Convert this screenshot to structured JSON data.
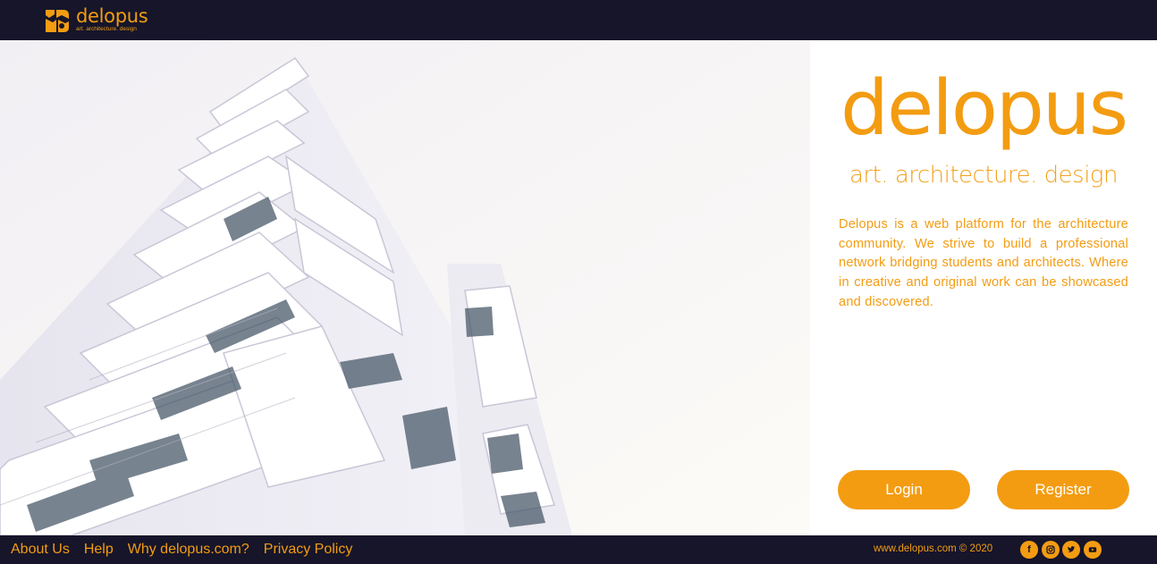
{
  "header": {
    "logo_name": "delopus",
    "logo_tagline": "art. architecture. design"
  },
  "hero": {
    "image": "white-high-rise-building-photo"
  },
  "panel": {
    "brand_name": "delopus",
    "brand_tagline": "art. architecture. design",
    "description": "Delopus is a web platform for the architecture community. We strive to build a professional network bridging students and architects. Where in creative and original work can be showcased and discovered.",
    "login_label": "Login",
    "register_label": "Register"
  },
  "footer": {
    "links": [
      "About Us",
      "Help",
      "Why delopus.com?",
      "Privacy Policy"
    ],
    "copyright": "www.delopus.com © 2020",
    "socials": [
      "facebook-icon",
      "instagram-icon",
      "twitter-icon",
      "youtube-icon"
    ]
  },
  "colors": {
    "accent": "#f39c12",
    "dark": "#16152a"
  }
}
